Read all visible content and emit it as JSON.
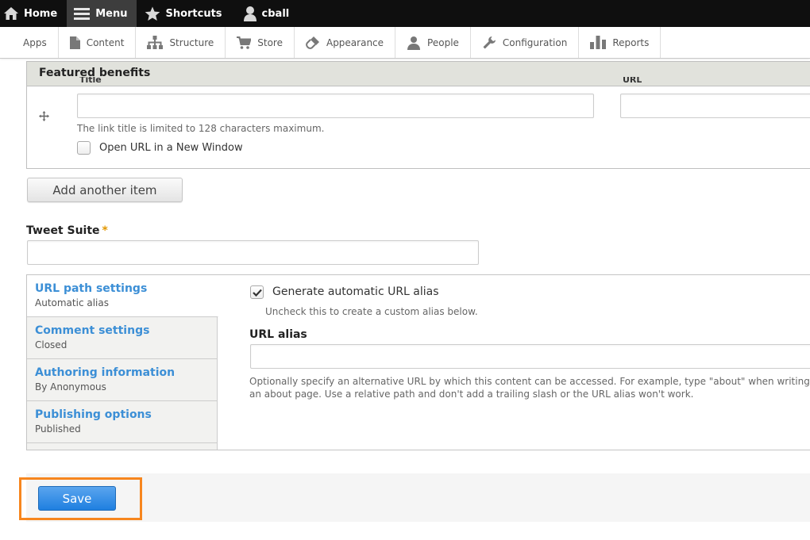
{
  "toolbar": {
    "items": [
      {
        "label": "Home",
        "icon": "home-icon"
      },
      {
        "label": "Menu",
        "icon": "hamburger-icon"
      },
      {
        "label": "Shortcuts",
        "icon": "star-icon"
      },
      {
        "label": "cball",
        "icon": "user-icon"
      }
    ]
  },
  "tray": {
    "items": [
      {
        "label": "Apps",
        "icon": ""
      },
      {
        "label": "Content",
        "icon": "file-icon"
      },
      {
        "label": "Structure",
        "icon": "sitemap-icon"
      },
      {
        "label": "Store",
        "icon": "cart-icon"
      },
      {
        "label": "Appearance",
        "icon": "paintbrush-icon"
      },
      {
        "label": "People",
        "icon": "person-icon"
      },
      {
        "label": "Configuration",
        "icon": "wrench-icon"
      },
      {
        "label": "Reports",
        "icon": "bar-chart-icon"
      }
    ]
  },
  "featured": {
    "header": "Featured benefits",
    "title_label": "Title",
    "url_label": "URL",
    "title_value": "",
    "url_value": "",
    "title_description": "The link title is limited to 128 characters maximum.",
    "new_window_label": "Open URL in a New Window",
    "new_window_checked": false,
    "add_button": "Add another item"
  },
  "tweet_suite": {
    "label": "Tweet Suite",
    "required_mark": "*",
    "value": ""
  },
  "vertical_tabs": {
    "tabs": [
      {
        "title": "URL path settings",
        "summary": "Automatic alias",
        "selected": true
      },
      {
        "title": "Comment settings",
        "summary": "Closed",
        "selected": false
      },
      {
        "title": "Authoring information",
        "summary": "By Anonymous",
        "selected": false
      },
      {
        "title": "Publishing options",
        "summary": "Published",
        "selected": false
      }
    ],
    "pane": {
      "generate_label": "Generate automatic URL alias",
      "generate_checked": true,
      "generate_description": "Uncheck this to create a custom alias below.",
      "alias_label": "URL alias",
      "alias_value": "",
      "alias_description": "Optionally specify an alternative URL by which this content can be accessed. For example, type \"about\" when writing an about page. Use a relative path and don't add a trailing slash or the URL alias won't work."
    }
  },
  "actions": {
    "save_label": "Save"
  },
  "colors": {
    "toolbar_bg": "#0f0f0f",
    "link_blue": "#3c8fd6",
    "save_blue": "#1f7fe0",
    "highlight_orange": "#f7861e",
    "required_orange": "#e29700"
  }
}
